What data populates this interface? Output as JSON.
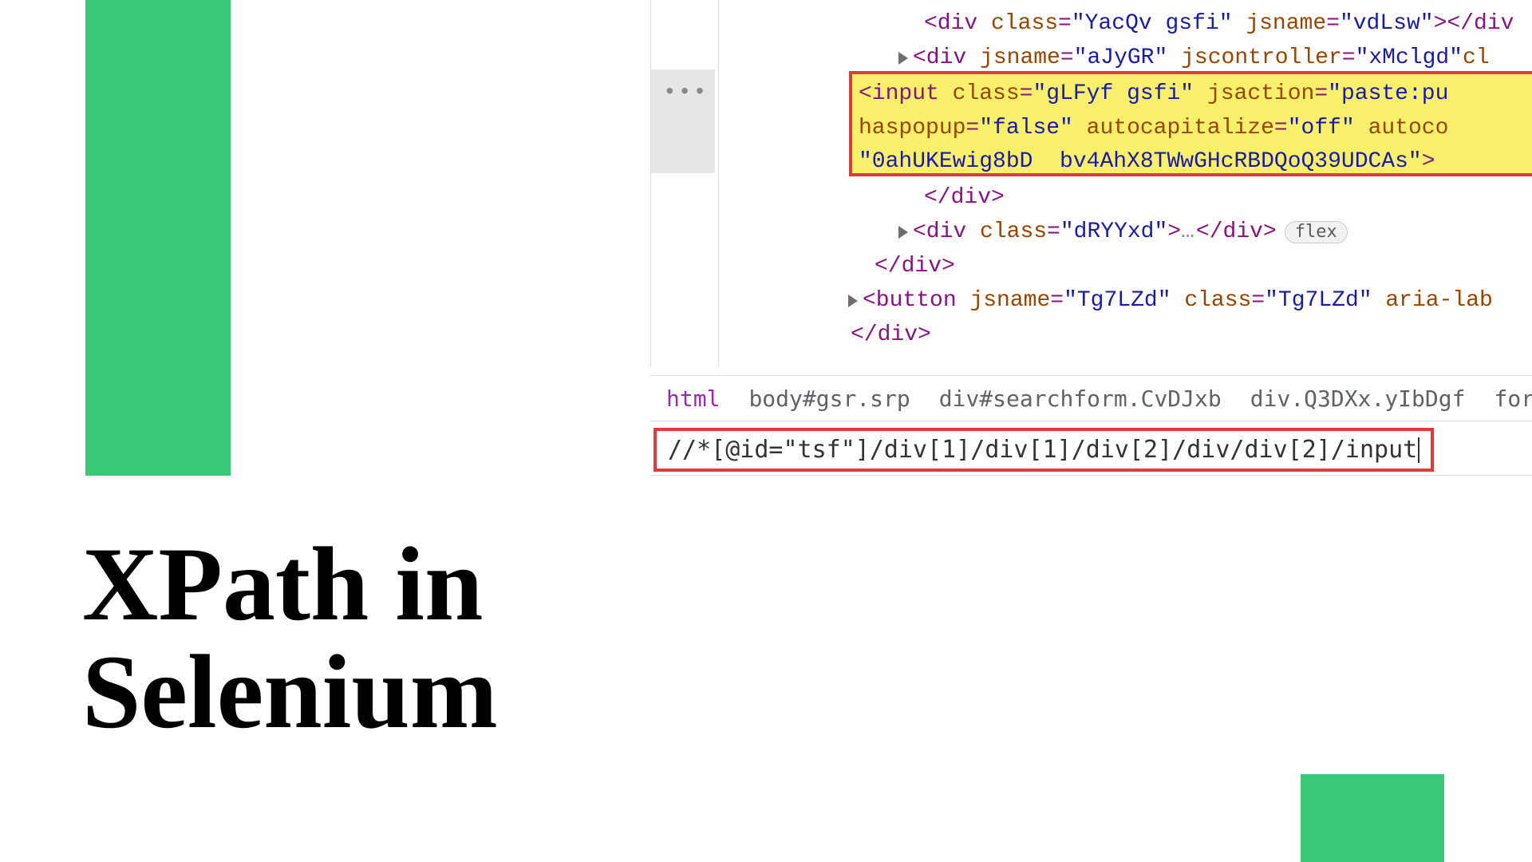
{
  "title_line1": "XPath in",
  "title_line2": "Selenium",
  "dom": {
    "line1_tag_open": "<div",
    "line1_attr1_name": "class",
    "line1_attr1_val": "\"YacQv gsfi\"",
    "line1_attr2_name": "jsname",
    "line1_attr2_val": "\"vdLsw\"",
    "line1_close": "></div",
    "line2_tag_open": "<div",
    "line2_attr1_name": "jsname",
    "line2_attr1_val": "\"aJyGR\"",
    "line2_attr2_name": "jscontroller",
    "line2_attr2_val": "\"xMclgd\"",
    "line2_close": " cl",
    "highlight_l1": "<input class=\"gLFyf gsfi\" jsaction=\"paste:pu",
    "highlight_l2": "haspopup=\"false\" autocapitalize=\"off\" autoco",
    "highlight_l3": "\"0ahUKEwig8bD  bv4AhX8TWwGHcRBDQoQ39UDCAs\">",
    "line3_closediv": "</div>",
    "line4_tag_open": "<div",
    "line4_attr1_name": "class",
    "line4_attr1_val": "\"dRYYxd\"",
    "line4_dots": "…",
    "line4_close": "</div>",
    "flex_label": "flex",
    "line5_closediv": "</div>",
    "line6_tag_open": "<button",
    "line6_attr1_name": "jsname",
    "line6_attr1_val": "\"Tg7LZd\"",
    "line6_attr2_name": "class",
    "line6_attr2_val": "\"Tg7LZd\"",
    "line6_attr3_name": "aria-lab",
    "line7_closediv": "</div>",
    "ellipsis": "•••"
  },
  "breadcrumb": {
    "c1": "html",
    "c2": "body#gsr.srp",
    "c3": "div#searchform.CvDJxb",
    "c4": "div.Q3DXx.yIbDgf",
    "c5": "form#tsf."
  },
  "xpath": "//*[@id=\"tsf\"]/div[1]/div[1]/div[2]/div/div[2]/input"
}
